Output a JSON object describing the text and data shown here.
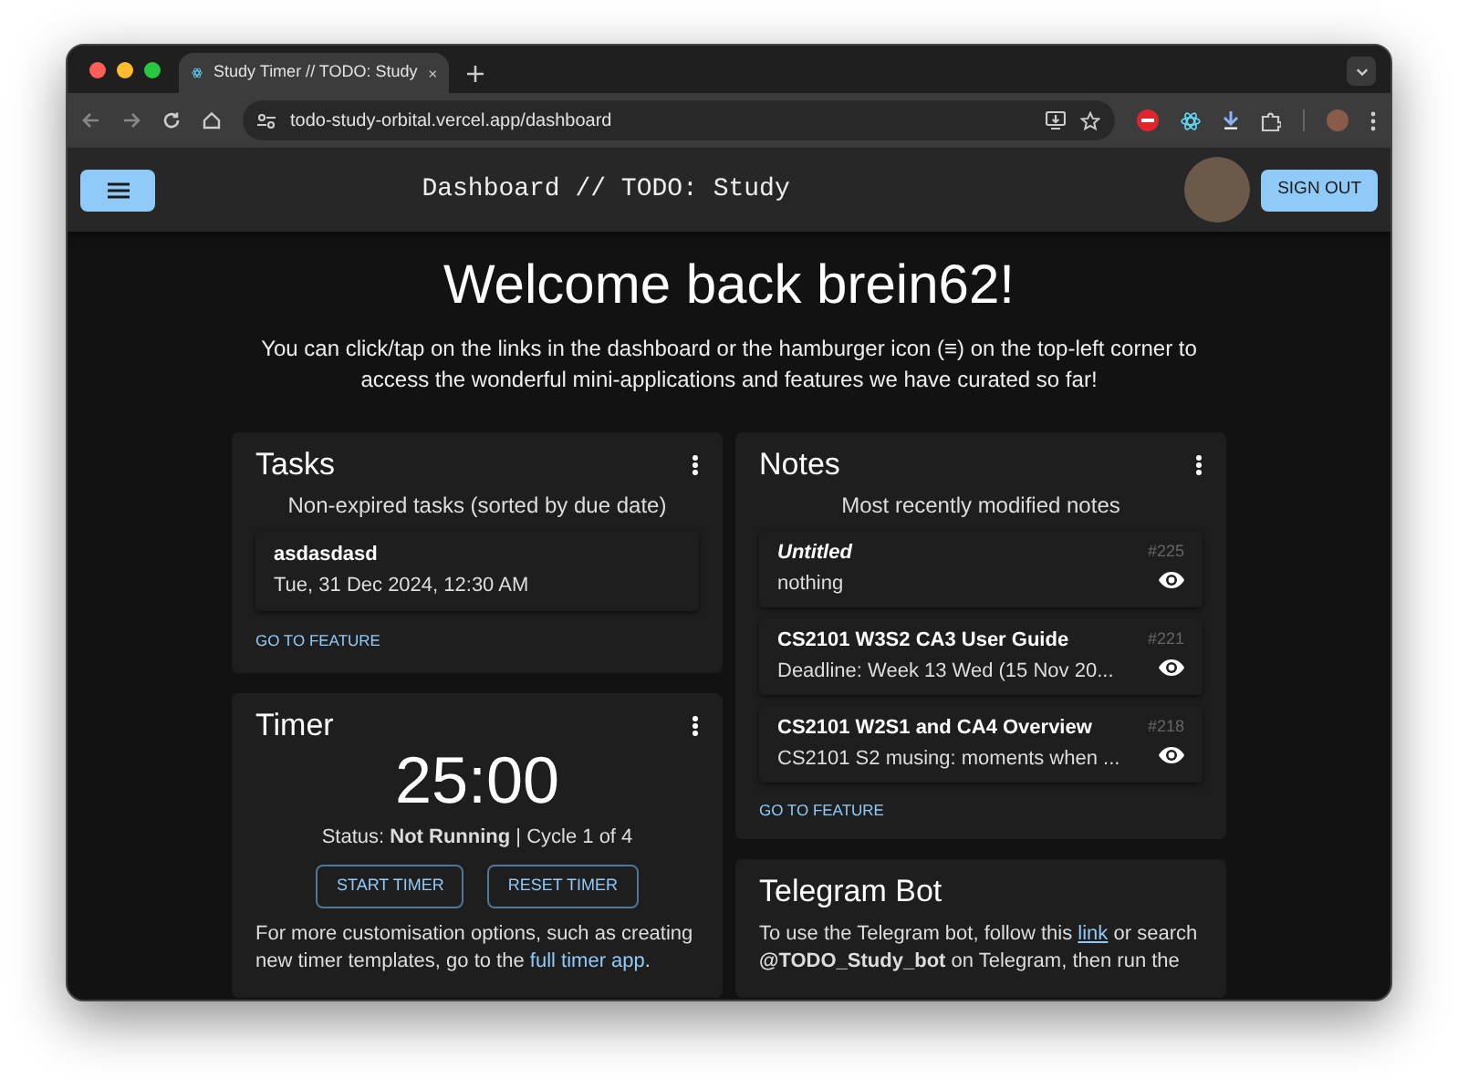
{
  "browser": {
    "tab": {
      "title": "Study Timer // TODO: Study",
      "selected": true
    },
    "url": "todo-study-orbital.vercel.app/dashboard"
  },
  "header": {
    "title": "Dashboard // TODO: Study",
    "sign_out": "SIGN OUT"
  },
  "welcome": {
    "title": "Welcome back brein62!",
    "intro": "You can click/tap on the links in the dashboard or the hamburger icon (≡) on the top-left corner to access the wonderful mini-applications and features we have curated so far!"
  },
  "tasks": {
    "title": "Tasks",
    "subtitle": "Non-expired tasks (sorted by due date)",
    "items": [
      {
        "name": "asdasdasd",
        "due": "Tue, 31 Dec 2024, 12:30 AM"
      }
    ],
    "link": "GO TO FEATURE"
  },
  "timer": {
    "title": "Timer",
    "time": "25:00",
    "status": "Status: **Not Running** | Cycle 1 of 4",
    "buttons": [
      "START TIMER",
      "RESET TIMER"
    ],
    "note_before": "For more customisation options, such as creating new timer templates, go to the ",
    "note_link": "full timer app",
    "note_after": "."
  },
  "notes": {
    "title": "Notes",
    "subtitle": "Most recently modified notes",
    "items": [
      {
        "title": "Untitled",
        "untitled": true,
        "preview": "nothing",
        "number": "#225"
      },
      {
        "title": "CS2101 W3S2 CA3 User Guide",
        "untitled": false,
        "preview": "Deadline: Week 13 Wed (15 Nov 20...",
        "number": "#221"
      },
      {
        "title": "CS2101 W2S1 and CA4 Overview",
        "untitled": false,
        "preview": "CS2101 S2 musing: moments when ...",
        "number": "#218"
      }
    ],
    "link": "GO TO FEATURE"
  },
  "telegram": {
    "title": "Telegram Bot",
    "text_before": "To use the Telegram bot, follow this ",
    "link": "link",
    "text_after": " or search **@TODO_Study_bot** on Telegram, then run the"
  }
}
